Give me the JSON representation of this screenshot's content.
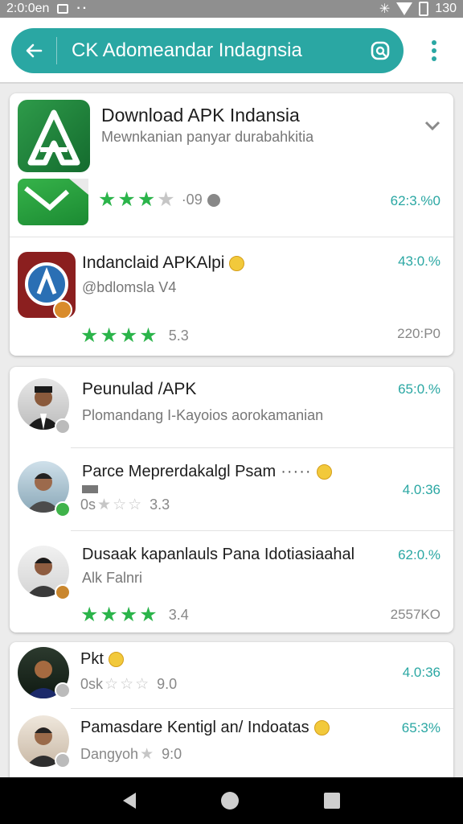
{
  "status_bar": {
    "time": "2:0:0en",
    "battery": "130"
  },
  "search": {
    "text": "CK Adomeandar Indagnsia"
  },
  "featured": {
    "title": "Download APK Indansia",
    "subtitle": "Mewnkanian panyar durabahkitia",
    "rating_text": "·09",
    "percent": "62:3.%0",
    "icon": "apk-logo-icon"
  },
  "item2": {
    "title": "Indanclaid APKAlpi",
    "subtitle": "@bdlomsla V4",
    "rating_text": "5.3",
    "percent": "43:0.%",
    "size": "220:P0"
  },
  "group": [
    {
      "title": "Peunulad /APK",
      "subtitle": "Plomandang I-Kayoios aorokamanian",
      "percent": "65:0.%",
      "rating_text": "",
      "size": ""
    },
    {
      "title": "Parce Meprerdakalgl Psam",
      "subtitle": "",
      "prefix": "0s",
      "rating_text": "3.3",
      "percent": "4.0:36",
      "size": ""
    },
    {
      "title": "Dusaak kapanlauls Pana Idotiasiaahal",
      "subtitle": "Alk Falnri",
      "rating_text": "3.4",
      "percent": "62:0.%",
      "size": "2557KO"
    }
  ],
  "group2": [
    {
      "title": "Pkt",
      "prefix": "0sk",
      "rating_text": "9.0",
      "percent": "4.0:36"
    },
    {
      "title": "Pamasdare Kentigl an/ Indoatas",
      "prefix": "Dangyoh",
      "rating_text": "9:0",
      "percent": "65:3%"
    }
  ],
  "colors": {
    "accent": "#2aa7a3",
    "star": "#2bb44a",
    "brand_green": "#1e8a3e"
  }
}
